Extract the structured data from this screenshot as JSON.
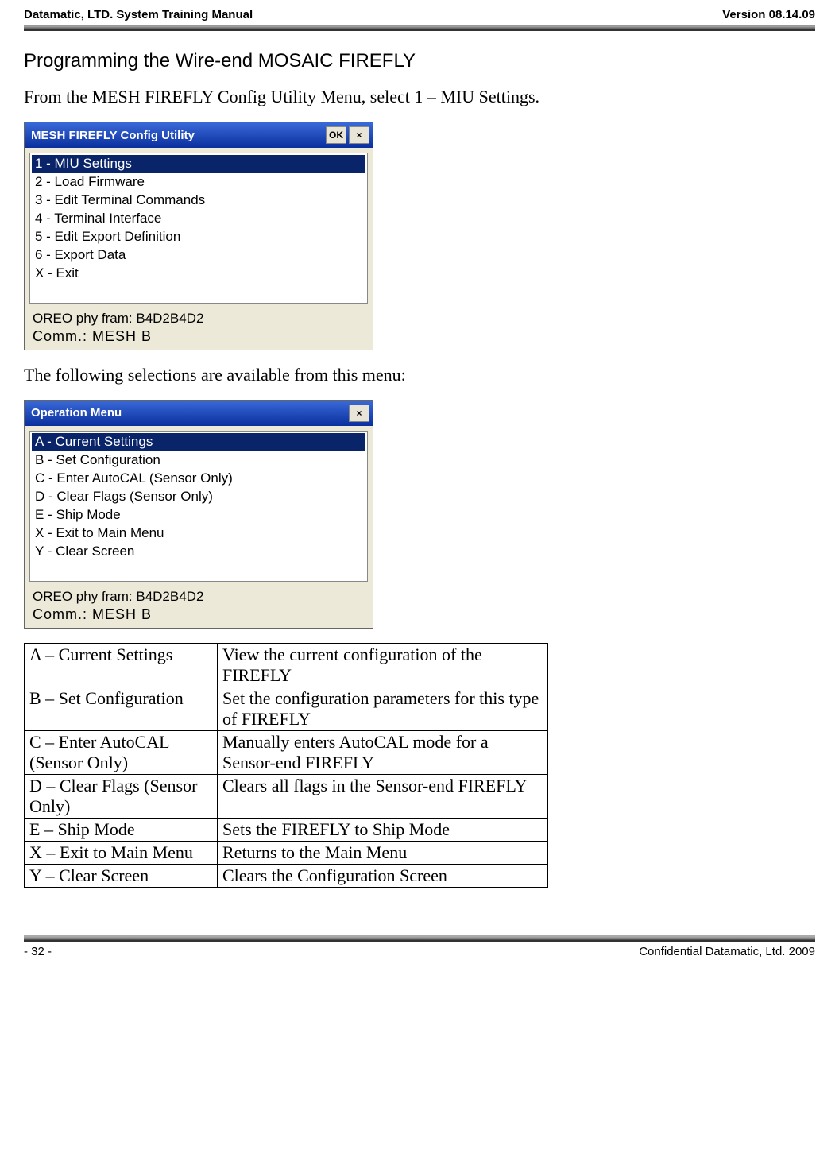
{
  "header": {
    "left": "Datamatic, LTD. System Training  Manual",
    "right": "Version 08.14.09"
  },
  "section_title": "Programming the Wire-end MOSAIC FIREFLY",
  "intro_text": "From the MESH FIREFLY Config Utility Menu, select 1 – MIU Settings.",
  "window1": {
    "title": "MESH FIREFLY Config Utility",
    "ok_label": "OK",
    "close_label": "×",
    "items": [
      "1 - MIU Settings",
      "2 - Load Firmware",
      "3 - Edit Terminal Commands",
      "4 - Terminal Interface",
      "5 - Edit Export Definition",
      "6 - Export Data",
      "X - Exit"
    ],
    "selected_index": 0,
    "status_line1": "OREO phy fram: B4D2B4D2",
    "status_line2": "Comm.: MESH  B"
  },
  "mid_text": "The following selections are available from this menu:",
  "window2": {
    "title": "Operation Menu",
    "close_label": "×",
    "items": [
      "A - Current Settings",
      "B - Set Configuration",
      "C - Enter AutoCAL (Sensor Only)",
      "D - Clear Flags (Sensor Only)",
      "E - Ship Mode",
      "X - Exit to Main Menu",
      "Y - Clear Screen"
    ],
    "selected_index": 0,
    "status_line1": "OREO phy fram: B4D2B4D2",
    "status_line2": "Comm.: MESH  B"
  },
  "table": {
    "rows": [
      {
        "opt": "A – Current Settings",
        "desc": "View the current configuration of the FIREFLY"
      },
      {
        "opt": "B – Set Configuration",
        "desc": "Set the configuration parameters for this type of FIREFLY"
      },
      {
        "opt": "C – Enter AutoCAL (Sensor Only)",
        "desc": "Manually enters AutoCAL mode for a Sensor-end FIREFLY"
      },
      {
        "opt": "D – Clear Flags (Sensor Only)",
        "desc": "Clears all flags in the Sensor-end FIREFLY"
      },
      {
        "opt": "E – Ship Mode",
        "desc": "Sets the FIREFLY to Ship Mode"
      },
      {
        "opt": "X – Exit to Main Menu",
        "desc": "Returns to the Main Menu"
      },
      {
        "opt": "Y – Clear Screen",
        "desc": "Clears the Configuration Screen"
      }
    ]
  },
  "footer": {
    "left": "- 32 -",
    "right": "Confidential Datamatic, Ltd. 2009"
  }
}
